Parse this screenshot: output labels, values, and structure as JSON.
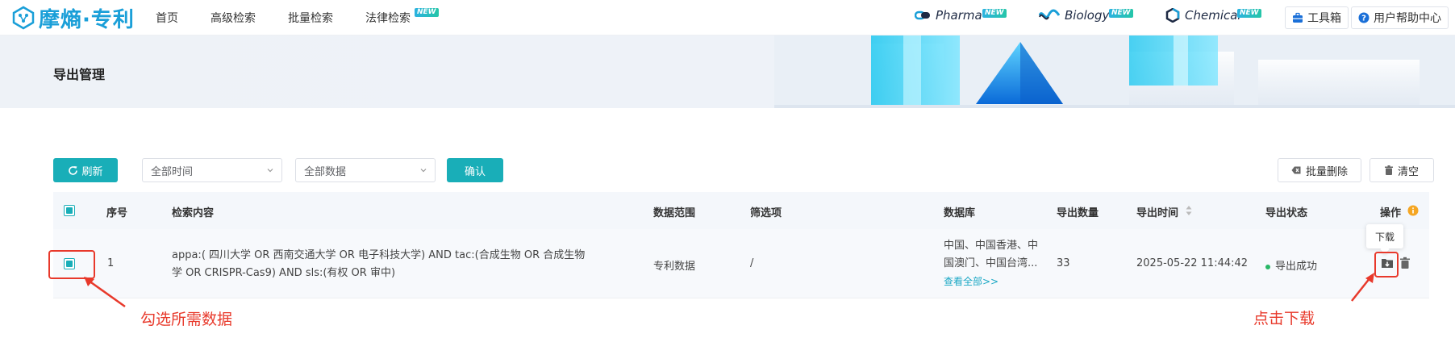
{
  "brand": {
    "logo_text": "摩熵·专利",
    "color": "#1a9fd8"
  },
  "nav": {
    "items": [
      {
        "label": "首页"
      },
      {
        "label": "高级检索"
      },
      {
        "label": "批量检索"
      },
      {
        "label": "法律检索",
        "badge": "NEW"
      }
    ]
  },
  "products": [
    {
      "label": "Pharma",
      "badge": "NEW",
      "icon": "pharma-icon"
    },
    {
      "label": "Biology",
      "badge": "NEW",
      "icon": "biology-icon"
    },
    {
      "label": "Chemical",
      "badge": "NEW",
      "icon": "chemical-icon"
    }
  ],
  "header_tools": {
    "toolbox_label": "工具箱",
    "help_label": "用户帮助中心"
  },
  "page": {
    "title": "导出管理"
  },
  "toolbar": {
    "refresh_label": "刷新",
    "time_select": "全部时间",
    "data_select": "全部数据",
    "confirm_label": "确认",
    "batch_delete_label": "批量删除",
    "clear_label": "清空"
  },
  "table": {
    "columns": {
      "index": "序号",
      "query": "检索内容",
      "scope": "数据范围",
      "filters": "筛选项",
      "database": "数据库",
      "count": "导出数量",
      "time": "导出时间",
      "status": "导出状态",
      "actions": "操作"
    },
    "rows": [
      {
        "index": "1",
        "query_line1": "appa:( 四川大学  OR  西南交通大学  OR  电子科技大学) AND tac:(合成生物 OR 合成生物",
        "query_line2": "学 OR CRISPR-Cas9) AND sls:(有权 OR 审中)",
        "scope": "专利数据",
        "filters": "/",
        "database_line1": "中国、中国香港、中",
        "database_line2": "国澳门、中国台湾...",
        "database_link": "查看全部>>",
        "count": "33",
        "time": "2025-05-22 11:44:42",
        "status": "导出成功"
      }
    ]
  },
  "tooltip": {
    "download": "下载"
  },
  "annotations": {
    "select_data": "勾选所需数据",
    "click_download": "点击下载"
  },
  "colors": {
    "accent": "#19aeb8",
    "annotation": "#e8392b",
    "success": "#28b766"
  }
}
